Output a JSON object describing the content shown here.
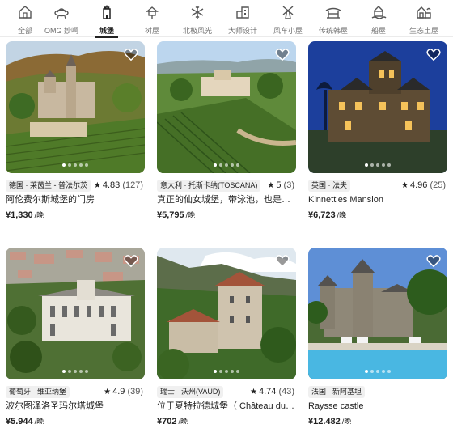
{
  "categories": [
    {
      "label": "全部",
      "icon": "house-icon",
      "active": false
    },
    {
      "label": "OMG 妙啊",
      "icon": "ufo-icon",
      "active": false
    },
    {
      "label": "城堡",
      "icon": "castle-icon",
      "active": true
    },
    {
      "label": "树屋",
      "icon": "treehouse-icon",
      "active": false
    },
    {
      "label": "北极风光",
      "icon": "snowflake-icon",
      "active": false
    },
    {
      "label": "大师设计",
      "icon": "design-building-icon",
      "active": false
    },
    {
      "label": "风车小屋",
      "icon": "windmill-icon",
      "active": false
    },
    {
      "label": "传统韩屋",
      "icon": "hanok-icon",
      "active": false
    },
    {
      "label": "船屋",
      "icon": "boathouse-icon",
      "active": false
    },
    {
      "label": "生态土屋",
      "icon": "earth-house-icon",
      "active": false
    }
  ],
  "listings": [
    {
      "location": "德国 · 莱茵兰 - 普法尔茨",
      "rating": "4.83",
      "reviews": "(127)",
      "title": "阿伦费尔斯城堡的门房",
      "price": "¥1,330",
      "unit": "/晚"
    },
    {
      "location": "意大利 · 托斯卡纳(TOSCANA)",
      "rating": "5",
      "reviews": "(3)",
      "title": "真正的仙女城堡，带泳池，也是婚礼…",
      "price": "¥5,795",
      "unit": "/晚"
    },
    {
      "location": "英国 · 法夫",
      "rating": "4.96",
      "reviews": "(25)",
      "title": "Kinnettles Mansion",
      "price": "¥6,723",
      "unit": "/晚"
    },
    {
      "location": "葡萄牙 · 维亚纳堡",
      "rating": "4.9",
      "reviews": "(39)",
      "title": "波尔图泽洛圣玛尔塔城堡",
      "price": "¥5,944",
      "unit": "/晚"
    },
    {
      "location": "瑞士 · 沃州(VAUD)",
      "rating": "4.74",
      "reviews": "(43)",
      "title": "位于夏特拉德城堡（ Château du C…",
      "price": "¥702",
      "unit": "/晚"
    },
    {
      "location": "法国 · 新阿基坦",
      "rating": "",
      "reviews": "",
      "title": "Raysse castle",
      "price": "¥12,482",
      "unit": "/晚"
    }
  ]
}
